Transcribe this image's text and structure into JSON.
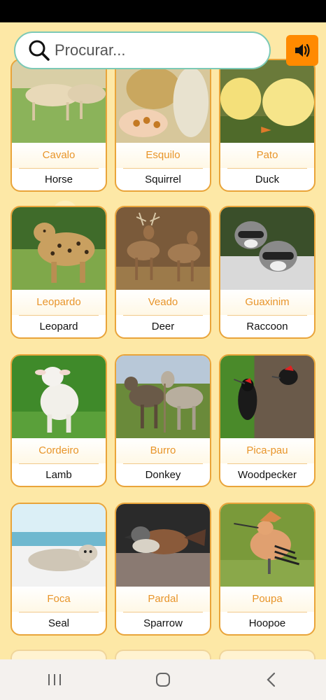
{
  "search": {
    "placeholder": "Procurar..."
  },
  "sound_button": {
    "icon": "speaker-icon",
    "color": "#ff8a00"
  },
  "accent": {
    "card_border": "#e9a43a",
    "portuguese_text": "#e8952a",
    "search_border": "#7cc9b6"
  },
  "animals": [
    {
      "pt": "Cavalo",
      "en": "Horse"
    },
    {
      "pt": "Esquilo",
      "en": "Squirrel"
    },
    {
      "pt": "Pato",
      "en": "Duck"
    },
    {
      "pt": "Leopardo",
      "en": "Leopard"
    },
    {
      "pt": "Veado",
      "en": "Deer"
    },
    {
      "pt": "Guaxinim",
      "en": "Raccoon"
    },
    {
      "pt": "Cordeiro",
      "en": "Lamb"
    },
    {
      "pt": "Burro",
      "en": "Donkey"
    },
    {
      "pt": "Pica-pau",
      "en": "Woodpecker"
    },
    {
      "pt": "Foca",
      "en": "Seal"
    },
    {
      "pt": "Pardal",
      "en": "Sparrow"
    },
    {
      "pt": "Poupa",
      "en": "Hoopoe"
    }
  ],
  "nav": {
    "recent": "recent-apps-icon",
    "home": "home-icon",
    "back": "back-icon"
  }
}
